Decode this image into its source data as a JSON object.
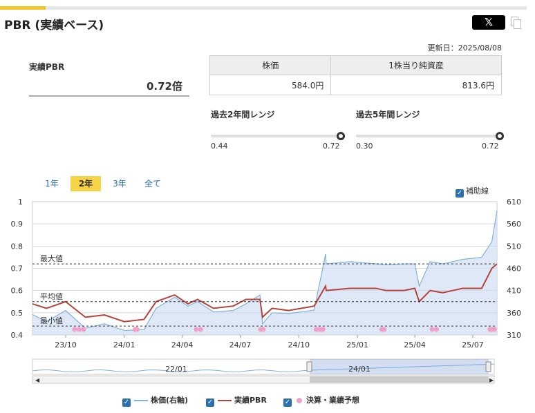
{
  "header": {
    "title": "PBR (実績ベース)",
    "share_label": "𝕏",
    "updated": "更新日：2025/08/08"
  },
  "summary": {
    "label": "実績PBR",
    "value": "0.72倍"
  },
  "info_table": {
    "headers": [
      "株価",
      "1株当り純資産"
    ],
    "values": [
      "584.0円",
      "813.6円"
    ]
  },
  "ranges": [
    {
      "label": "過去2年間レンジ",
      "min": "0.44",
      "max": "0.72",
      "position": 1.0
    },
    {
      "label": "過去5年間レンジ",
      "min": "0.30",
      "max": "0.72",
      "position": 1.0
    }
  ],
  "period_tabs": [
    {
      "label": "1年",
      "active": false
    },
    {
      "label": "2年",
      "active": true
    },
    {
      "label": "3年",
      "active": false
    },
    {
      "label": "全て",
      "active": false
    }
  ],
  "aux_toggle": {
    "label": "補助線",
    "checked": true
  },
  "legend": [
    {
      "label": "株価(右軸)",
      "color": "#7fb2de"
    },
    {
      "label": "実績PBR",
      "color": "#b5433d"
    },
    {
      "label": "決算・業績予想",
      "color": "#f2a0c8"
    }
  ],
  "colors": {
    "accent": "#f3c522",
    "pbr": "#b5433d",
    "price": "#7fb2de",
    "price_fill": "#c9d8f0",
    "event": "#f2a0c8",
    "link": "#2a6fb0"
  },
  "chart_data": {
    "type": "line",
    "left_axis": {
      "ticks": [
        "1",
        "0.9",
        "0.8",
        "0.7",
        "0.6",
        "0.5",
        "0.4"
      ],
      "ylim": [
        0.4,
        1.0
      ]
    },
    "right_axis": {
      "ticks": [
        "610",
        "560",
        "510",
        "460",
        "410",
        "360",
        "310"
      ],
      "ylim": [
        310,
        610
      ]
    },
    "x_ticks": [
      "23/10",
      "24/01",
      "24/04",
      "24/07",
      "24/10",
      "25/01",
      "25/04",
      "25/07"
    ],
    "reference_lines": [
      {
        "label": "最大値",
        "value": 0.72
      },
      {
        "label": "平均値",
        "value": 0.55
      },
      {
        "label": "最小値",
        "value": 0.44
      }
    ],
    "series": [
      {
        "name": "実績PBR",
        "x": [
          "2023-08-10",
          "2023-09-01",
          "2023-10-01",
          "2023-11-01",
          "2023-12-01",
          "2024-01-01",
          "2024-02-01",
          "2024-02-20",
          "2024-03-20",
          "2024-04-10",
          "2024-04-25",
          "2024-05-20",
          "2024-06-20",
          "2024-07-10",
          "2024-08-01",
          "2024-08-05",
          "2024-08-20",
          "2024-09-15",
          "2024-10-25",
          "2024-11-12",
          "2024-11-13",
          "2024-12-20",
          "2025-01-30",
          "2025-02-15",
          "2025-03-15",
          "2025-04-01",
          "2025-04-08",
          "2025-04-25",
          "2025-05-15",
          "2025-06-15",
          "2025-07-15",
          "2025-07-31",
          "2025-08-08"
        ],
        "values": [
          0.54,
          0.52,
          0.55,
          0.48,
          0.49,
          0.46,
          0.47,
          0.55,
          0.58,
          0.54,
          0.56,
          0.52,
          0.53,
          0.56,
          0.56,
          0.48,
          0.52,
          0.51,
          0.53,
          0.62,
          0.6,
          0.61,
          0.61,
          0.6,
          0.6,
          0.61,
          0.55,
          0.6,
          0.59,
          0.61,
          0.61,
          0.7,
          0.72
        ]
      },
      {
        "name": "株価(右軸)",
        "x": [
          "2023-08-10",
          "2023-09-01",
          "2023-10-01",
          "2023-11-01",
          "2023-12-01",
          "2024-01-01",
          "2024-02-01",
          "2024-02-20",
          "2024-03-20",
          "2024-04-10",
          "2024-04-25",
          "2024-05-20",
          "2024-06-20",
          "2024-07-10",
          "2024-08-01",
          "2024-08-05",
          "2024-08-20",
          "2024-09-15",
          "2024-10-25",
          "2024-11-12",
          "2024-11-13",
          "2024-12-20",
          "2025-01-30",
          "2025-02-15",
          "2025-03-15",
          "2025-04-01",
          "2025-04-08",
          "2025-04-25",
          "2025-05-15",
          "2025-06-15",
          "2025-07-15",
          "2025-07-31",
          "2025-08-08"
        ],
        "values": [
          356,
          340,
          365,
          325,
          335,
          320,
          322,
          370,
          395,
          375,
          385,
          362,
          365,
          380,
          400,
          335,
          360,
          358,
          366,
          492,
          470,
          475,
          470,
          468,
          470,
          470,
          420,
          475,
          470,
          480,
          485,
          520,
          590
        ]
      }
    ],
    "events": [
      "2023-10-15",
      "2023-10-22",
      "2023-10-29",
      "2024-01-18",
      "2024-01-21",
      "2024-04-23",
      "2024-04-30",
      "2024-08-02",
      "2024-08-06",
      "2024-10-28",
      "2024-11-01",
      "2024-11-05",
      "2024-11-08",
      "2025-02-08",
      "2025-02-12",
      "2025-04-28",
      "2025-05-05",
      "2025-07-28",
      "2025-07-31",
      "2025-08-04"
    ],
    "navigator": {
      "labels": [
        "22/01",
        "24/01"
      ]
    }
  }
}
